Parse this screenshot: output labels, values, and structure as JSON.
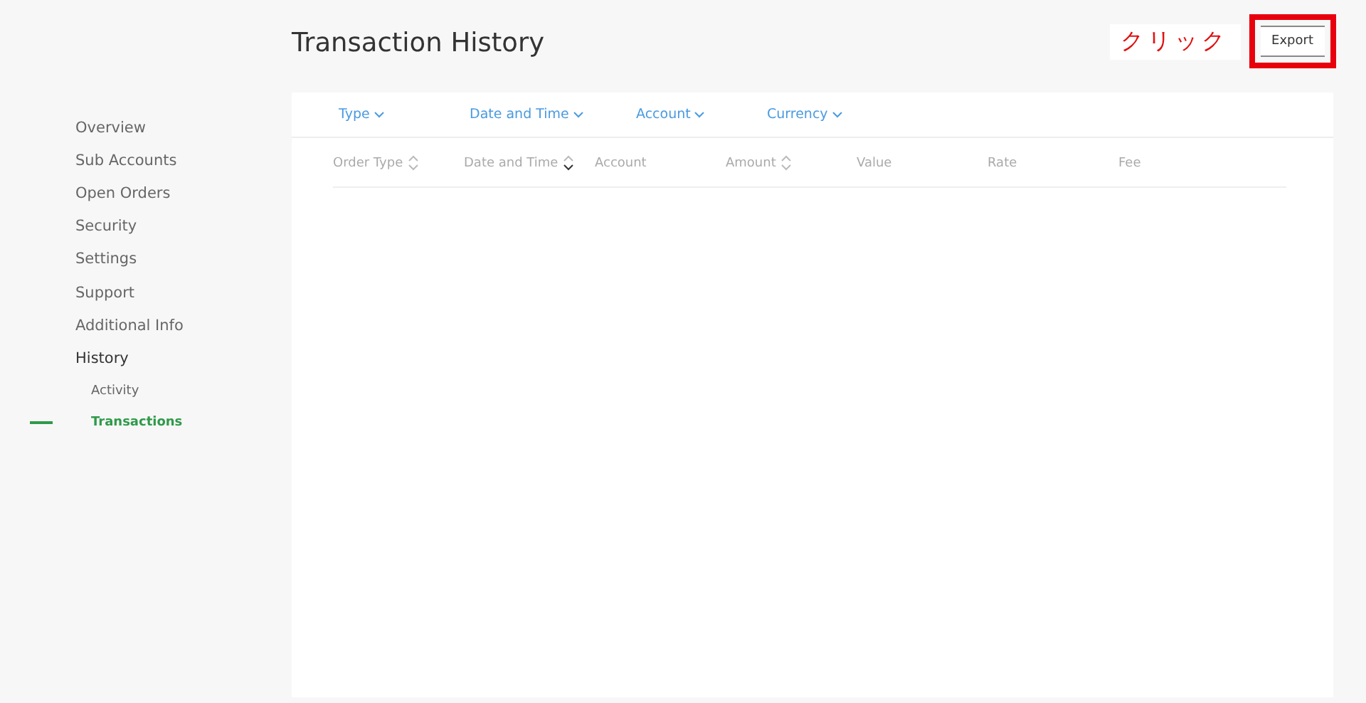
{
  "sidebar": {
    "items": [
      {
        "label": "Overview",
        "selected": false,
        "expanded": false
      },
      {
        "label": "Sub Accounts",
        "selected": false,
        "expanded": false
      },
      {
        "label": "Open Orders",
        "selected": false,
        "expanded": false
      },
      {
        "label": "Security",
        "selected": false,
        "expanded": false
      },
      {
        "label": "Settings",
        "selected": false,
        "expanded": false
      },
      {
        "label": "Support",
        "selected": false,
        "expanded": false
      },
      {
        "label": "Additional Info",
        "selected": false,
        "expanded": false
      },
      {
        "label": "History",
        "selected": false,
        "expanded": true,
        "children": [
          {
            "label": "Activity",
            "selected": false
          },
          {
            "label": "Transactions",
            "selected": true
          }
        ]
      }
    ]
  },
  "page": {
    "title": "Transaction History"
  },
  "annotation": {
    "text": "クリック"
  },
  "export_button": {
    "label": "Export",
    "highlighted": true
  },
  "filters": [
    {
      "label": "Type"
    },
    {
      "label": "Date and Time"
    },
    {
      "label": "Account"
    },
    {
      "label": "Currency"
    }
  ],
  "table": {
    "columns": [
      {
        "label": "Order Type",
        "sortable": true,
        "sorted_descending": false
      },
      {
        "label": "Date and Time",
        "sortable": true,
        "sorted_descending": true
      },
      {
        "label": "Account",
        "sortable": false
      },
      {
        "label": "Amount",
        "sortable": true,
        "sorted_descending": false
      },
      {
        "label": "Value",
        "sortable": false
      },
      {
        "label": "Rate",
        "sortable": false
      },
      {
        "label": "Fee",
        "sortable": false
      }
    ]
  }
}
